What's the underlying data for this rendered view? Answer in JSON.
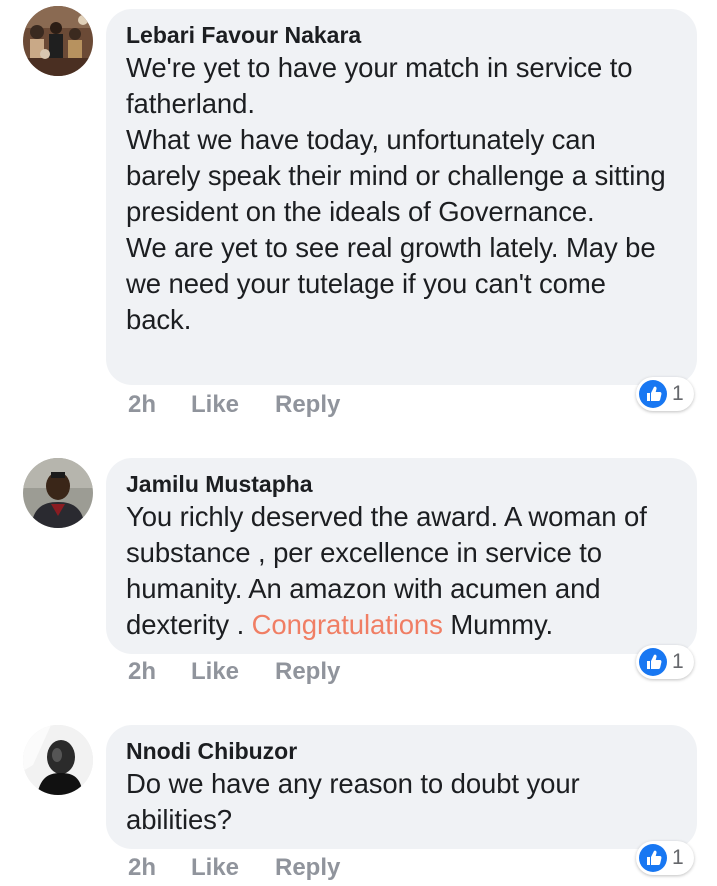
{
  "colors": {
    "bubble_bg": "#f0f2f5",
    "action_text": "#90949c",
    "highlight": "#f07e64",
    "like_blue": "#1877f2"
  },
  "comments": [
    {
      "author": "Lebari Favour Nakara",
      "avatar_icon": "avatar-photo",
      "paragraphs": [
        "We're yet to have your match in service to fatherland.",
        "What we have today, unfortunately can barely speak their mind or challenge a sitting president on the ideals of Governance.",
        "We are yet to see real growth lately. May be we need your tutelage if you  can't come back."
      ],
      "time": "2h",
      "like_label": "Like",
      "reply_label": "Reply",
      "reaction_icon": "thumbs-up-icon",
      "reaction_count": "1"
    },
    {
      "author": "Jamilu Mustapha",
      "avatar_icon": "avatar-photo",
      "text_before": "You richly deserved the award. A woman of substance , per excellence in service to humanity.  An amazon with acumen and dexterity . ",
      "text_highlight": "Congratulations",
      "text_after": " Mummy.",
      "time": "2h",
      "like_label": "Like",
      "reply_label": "Reply",
      "reaction_icon": "thumbs-up-icon",
      "reaction_count": "1"
    },
    {
      "author": "Nnodi Chibuzor",
      "avatar_icon": "avatar-photo",
      "paragraphs": [
        "Do we have any reason to doubt your abilities?"
      ],
      "time": "2h",
      "like_label": "Like",
      "reply_label": "Reply",
      "reaction_icon": "thumbs-up-icon",
      "reaction_count": "1"
    }
  ]
}
